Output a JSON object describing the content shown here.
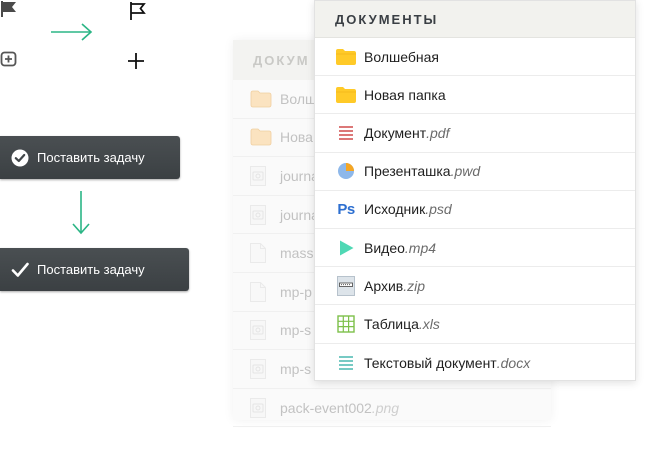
{
  "task_button_label": "Поставить задачу",
  "background_list": {
    "header": "ДОКУМ",
    "rows": [
      {
        "icon": "folder-icon",
        "name": "Волш",
        "ext": ""
      },
      {
        "icon": "folder-icon",
        "name": "Нова",
        "ext": ""
      },
      {
        "icon": "image-file-icon",
        "name": "journa",
        "ext": ""
      },
      {
        "icon": "image-file-icon",
        "name": "journa",
        "ext": ""
      },
      {
        "icon": "blank-file-icon",
        "name": "mass",
        "ext": ""
      },
      {
        "icon": "blank-file-icon",
        "name": "mp-p",
        "ext": ""
      },
      {
        "icon": "image-file-icon",
        "name": "mp-s",
        "ext": ""
      },
      {
        "icon": "image-file-icon",
        "name": "mp-s",
        "ext": ""
      },
      {
        "icon": "image-file-icon",
        "name": "pack-event002",
        "ext": ".png"
      }
    ]
  },
  "documents": {
    "header": "ДОКУМЕНТЫ",
    "rows": [
      {
        "icon": "folder-icon",
        "name": "Волшебная",
        "ext": ""
      },
      {
        "icon": "folder-icon",
        "name": "Новая папка",
        "ext": ""
      },
      {
        "icon": "pdf-icon",
        "name": "Документ",
        "ext": ".pdf"
      },
      {
        "icon": "pie-chart-icon",
        "name": "Презенташка",
        "ext": ".pwd"
      },
      {
        "icon": "photoshop-icon",
        "icon_text": "Ps",
        "name": "Исходник",
        "ext": ".psd"
      },
      {
        "icon": "play-icon",
        "name": "Видео",
        "ext": ".mp4"
      },
      {
        "icon": "archive-icon",
        "name": "Архив",
        "ext": ".zip"
      },
      {
        "icon": "spreadsheet-icon",
        "name": "Таблица",
        "ext": ".xls"
      },
      {
        "icon": "text-doc-icon",
        "name": "Текстовый документ",
        "ext": ".docx"
      }
    ]
  },
  "colors": {
    "arrow": "#2bb585",
    "folder": "#ffca28",
    "pdf": "#d14b4b",
    "pie_blue": "#8eb8ea",
    "pie_orange": "#f5a623",
    "photoshop": "#2d6fd0",
    "play": "#4fd8b4",
    "spreadsheet": "#7dc04a",
    "text_doc": "#4ab8b0",
    "button_bg": "#42474a"
  }
}
